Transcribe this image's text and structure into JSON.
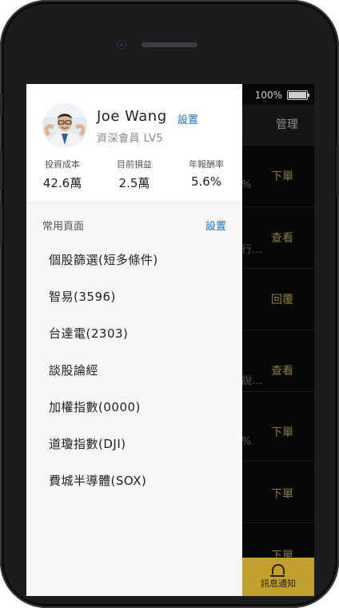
{
  "background_app": {
    "battery": "100%",
    "manage_label": "管理",
    "rows": [
      {
        "action": "下單",
        "fragment": "%"
      },
      {
        "action": "查看",
        "fragment": "行…"
      },
      {
        "action": "回覆",
        "fragment": ""
      },
      {
        "action": "查看",
        "fragment": "說…"
      },
      {
        "action": "下單",
        "fragment": "%"
      },
      {
        "action": "下單",
        "fragment": ""
      },
      {
        "action": "下單",
        "fragment": ""
      }
    ],
    "notify_label": "訊息通知"
  },
  "profile": {
    "name": "Joe Wang",
    "settings_label": "設置",
    "level": "資深會員 LV5",
    "stats": [
      {
        "label": "投資成本",
        "value": "42.6萬"
      },
      {
        "label": "目前損益",
        "value": "2.5萬"
      },
      {
        "label": "年報酬率",
        "value": "5.6%"
      }
    ]
  },
  "shortcuts": {
    "title": "常用頁面",
    "settings_label": "設置",
    "items": [
      "個股篩選(短多條件)",
      "智易(3596)",
      "台達電(2303)",
      "談股論經",
      "加權指數(0000)",
      "道瓊指數(DJI)",
      "費城半導體(SOX)"
    ]
  },
  "icons": [
    "camera-icon",
    "battery-icon",
    "bell-icon",
    "avatar"
  ],
  "colors": {
    "accent": "#1d6fc9",
    "notify": "#c2a030",
    "drawer_bg": "#f7f7f7"
  }
}
